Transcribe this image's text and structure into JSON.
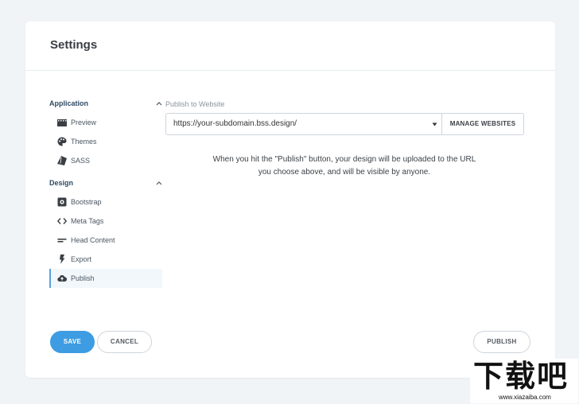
{
  "page": {
    "title": "Settings"
  },
  "sidebar": {
    "groups": [
      {
        "label": "Application",
        "items": [
          {
            "label": "Preview",
            "icon": "film-icon"
          },
          {
            "label": "Themes",
            "icon": "palette-icon"
          },
          {
            "label": "SASS",
            "icon": "sass-icon"
          }
        ]
      },
      {
        "label": "Design",
        "items": [
          {
            "label": "Bootstrap",
            "icon": "bootstrap-icon"
          },
          {
            "label": "Meta Tags",
            "icon": "code-icon"
          },
          {
            "label": "Head Content",
            "icon": "lines-icon"
          },
          {
            "label": "Export",
            "icon": "bolt-icon"
          },
          {
            "label": "Publish",
            "icon": "cloud-upload-icon",
            "active": true
          }
        ]
      }
    ]
  },
  "publish": {
    "label": "Publish to Website",
    "url": "https://your-subdomain.bss.design/",
    "manage_label": "MANAGE WEBSITES",
    "info_line1": "When you hit the \"Publish\" button, your design will be uploaded to the URL",
    "info_line2": "you choose above, and will be visible by anyone."
  },
  "footer": {
    "save_label": "SAVE",
    "cancel_label": "CANCEL",
    "publish_label": "PUBLISH"
  },
  "watermark": {
    "main": "下载吧",
    "sub": "www.xiazaiba.com"
  },
  "colors": {
    "accent": "#3d9ce2",
    "background": "#f1f4f7"
  }
}
